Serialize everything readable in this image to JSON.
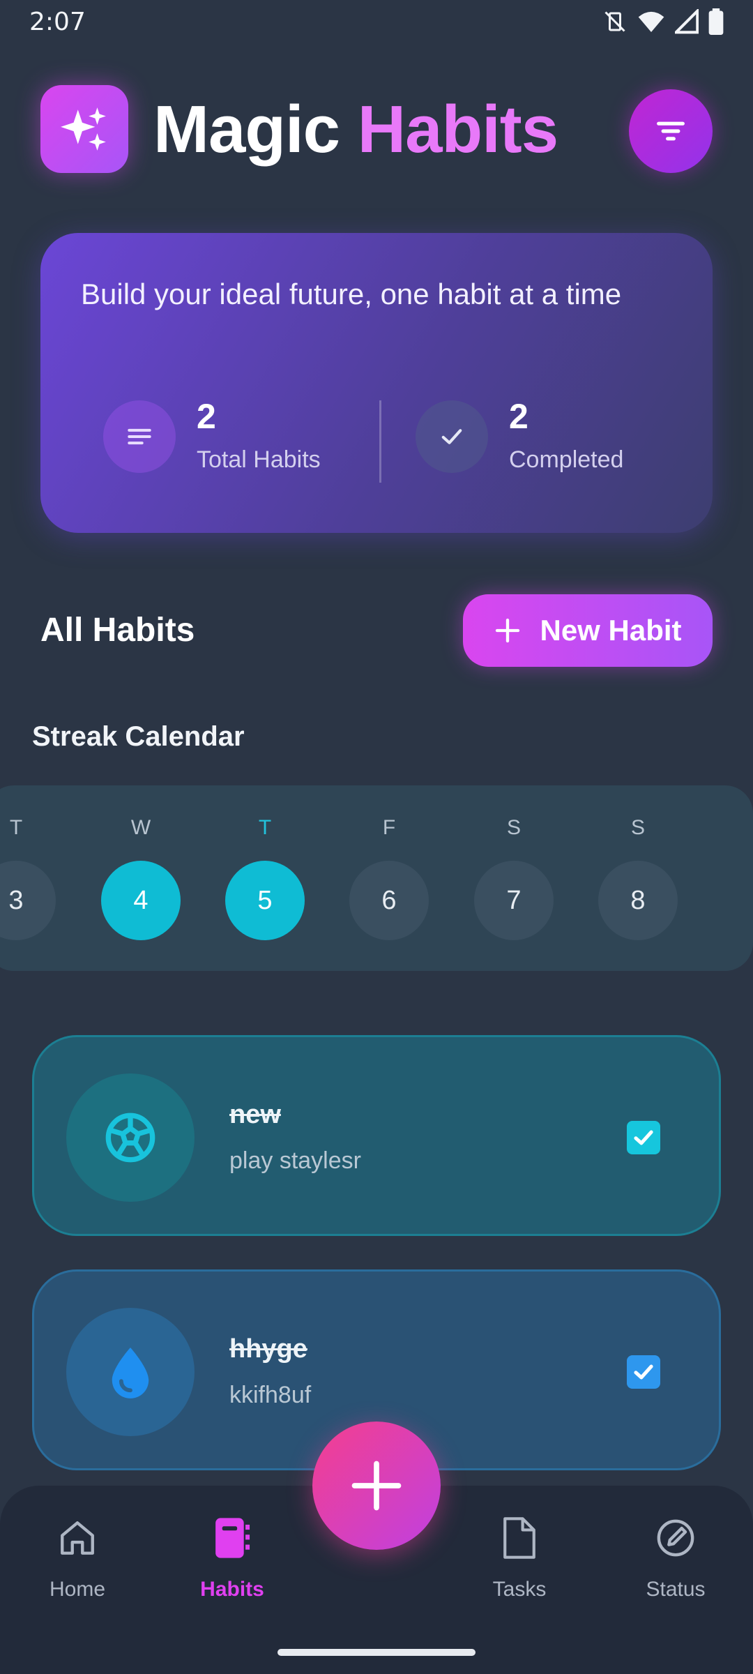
{
  "status_bar": {
    "time": "2:07"
  },
  "header": {
    "title_word1": "Magic",
    "title_word2": "Habits"
  },
  "hero": {
    "tagline": "Build your ideal future, one habit at a time",
    "stats": [
      {
        "value": "2",
        "label": "Total Habits"
      },
      {
        "value": "2",
        "label": "Completed"
      }
    ]
  },
  "section": {
    "title": "All Habits",
    "new_habit_label": "New Habit"
  },
  "calendar": {
    "title": "Streak Calendar",
    "days": [
      {
        "letter": "T",
        "num": "3",
        "active": false,
        "today": false
      },
      {
        "letter": "W",
        "num": "4",
        "active": true,
        "today": false
      },
      {
        "letter": "T",
        "num": "5",
        "active": true,
        "today": true
      },
      {
        "letter": "F",
        "num": "6",
        "active": false,
        "today": false
      },
      {
        "letter": "S",
        "num": "7",
        "active": false,
        "today": false
      },
      {
        "letter": "S",
        "num": "8",
        "active": false,
        "today": false
      }
    ]
  },
  "habits": [
    {
      "name": "new",
      "description": "play staylesr",
      "icon": "soccer-ball-icon",
      "completed": true
    },
    {
      "name": "hhyge",
      "description": "kkifh8uf",
      "icon": "water-drop-icon",
      "completed": true
    }
  ],
  "nav": {
    "items": [
      {
        "label": "Home",
        "icon": "home-icon"
      },
      {
        "label": "Habits",
        "icon": "notebook-icon"
      },
      {
        "label": "Tasks",
        "icon": "file-icon"
      },
      {
        "label": "Status",
        "icon": "edit-icon"
      }
    ],
    "active": "Habits"
  },
  "colors": {
    "background": "#2b3545",
    "accent_magenta": "#d946ef",
    "accent_purple": "#a855f7",
    "calendar_active": "#0fbcd4",
    "fab_pink": "#f43f8e"
  }
}
